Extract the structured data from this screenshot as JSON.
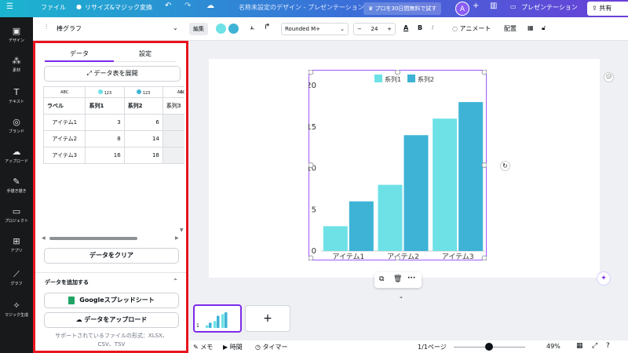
{
  "topbar": {
    "menu_icon": "hamburger-icon",
    "file": "ファイル",
    "resize": "リサイズ&マジック変換",
    "doc_title": "名称未設定のデザイン - プレゼンテーション",
    "trial": "プロを30日間無料で試す",
    "avatar": "A",
    "present": "プレゼンテーション",
    "share": "共有"
  },
  "rail": {
    "items": [
      {
        "icon": "design-icon",
        "label": "デザイン"
      },
      {
        "icon": "elements-icon",
        "label": "素材"
      },
      {
        "icon": "text-icon",
        "label": "テキスト"
      },
      {
        "icon": "brand-icon",
        "label": "ブランド"
      },
      {
        "icon": "upload-icon",
        "label": "アップロード"
      },
      {
        "icon": "draw-icon",
        "label": "手描き描き"
      },
      {
        "icon": "project-icon",
        "label": "プロジェクト"
      },
      {
        "icon": "apps-icon",
        "label": "アプリ"
      },
      {
        "icon": "graph-icon",
        "label": "グラフ"
      },
      {
        "icon": "magic-icon",
        "label": "マジック生成"
      }
    ]
  },
  "toolbar": {
    "chart_type": "棒グラフ",
    "edit": "編集",
    "color1": "#6ee1e6",
    "color2": "#3eb3d6",
    "font": "Rounded M+",
    "font_size": "24",
    "bold": "B",
    "italic": "I",
    "animate": "アニメート",
    "position": "配置"
  },
  "panel": {
    "tab_data": "データ",
    "tab_settings": "設定",
    "expand_table": "データ表を展開",
    "table": {
      "type_row": [
        "ABC",
        "123",
        "123",
        "ABC"
      ],
      "header": [
        "ラベル",
        "系列1",
        "系列2",
        "系列3"
      ],
      "rows": [
        [
          "アイテム1",
          "3",
          "6",
          ""
        ],
        [
          "アイテム2",
          "8",
          "14",
          ""
        ],
        [
          "アイテム3",
          "16",
          "18",
          ""
        ]
      ]
    },
    "clear": "データをクリア",
    "add_data": "データを追加する",
    "google_sheets": "Googleスプレッドシート",
    "upload_data": "データをアップロード",
    "supported_formats": "サポートされているファイルの形式：XLSX、CSV、TSV"
  },
  "bottombar": {
    "memo": "メモ",
    "time": "時間",
    "timer": "タイマー",
    "page": "1/1ページ",
    "zoom": "49%",
    "zoom_fraction": 0.49,
    "slide_number": "1",
    "add_page": "+"
  },
  "chart_data": {
    "type": "bar",
    "categories": [
      "アイテム1",
      "アイテム2",
      "アイテム3"
    ],
    "series": [
      {
        "name": "系列1",
        "values": [
          3,
          8,
          16
        ],
        "color": "#6ee1e6"
      },
      {
        "name": "系列2",
        "values": [
          6,
          14,
          18
        ],
        "color": "#3eb3d6"
      }
    ],
    "ylim": [
      0,
      20
    ],
    "yticks": [
      "0",
      "5",
      "10",
      "15",
      "20"
    ],
    "legend": "top-center",
    "grid": false
  }
}
